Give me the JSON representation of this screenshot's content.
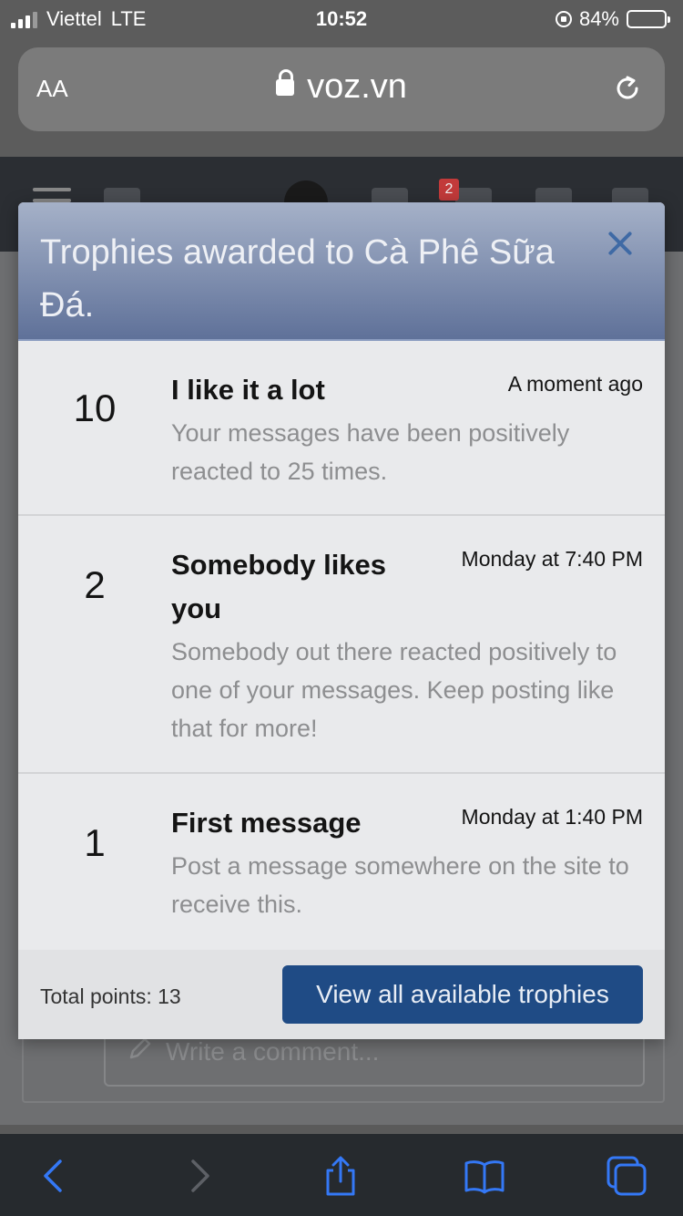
{
  "status_bar": {
    "carrier": "Viettel",
    "network": "LTE",
    "time": "10:52",
    "battery": "84%"
  },
  "browser": {
    "text_size_label": "AA",
    "domain": "voz.vn"
  },
  "site_header": {
    "notification_count": "2"
  },
  "modal": {
    "title": "Trophies awarded to Cà Phê Sữa Đá.",
    "trophies": [
      {
        "points": "10",
        "title": "I like it a lot",
        "time": "A moment ago",
        "description": "Your messages have been positively reacted to 25 times."
      },
      {
        "points": "2",
        "title": "Somebody likes you",
        "time": "Monday at 7:40 PM",
        "description": "Somebody out there reacted positively to one of your messages. Keep posting like that for more!"
      },
      {
        "points": "1",
        "title": "First message",
        "time": "Monday at 1:40 PM",
        "description": "Post a message somewhere on the site to receive this."
      }
    ],
    "total_points": "Total points: 13",
    "view_all_label": "View all available trophies"
  },
  "comment": {
    "placeholder": "Write a comment..."
  },
  "colors": {
    "accent": "#1f4b85",
    "header_gradient_top": "#a5b1c8",
    "header_gradient_bottom": "#5f7199",
    "toolbar_icon": "#3478f6"
  },
  "icons": [
    "signal-icon",
    "rotation-lock-icon",
    "battery-icon",
    "padlock-icon",
    "reload-icon",
    "close-icon",
    "pencil-icon",
    "back-icon",
    "forward-icon",
    "share-icon",
    "bookmarks-icon",
    "tabs-icon"
  ]
}
